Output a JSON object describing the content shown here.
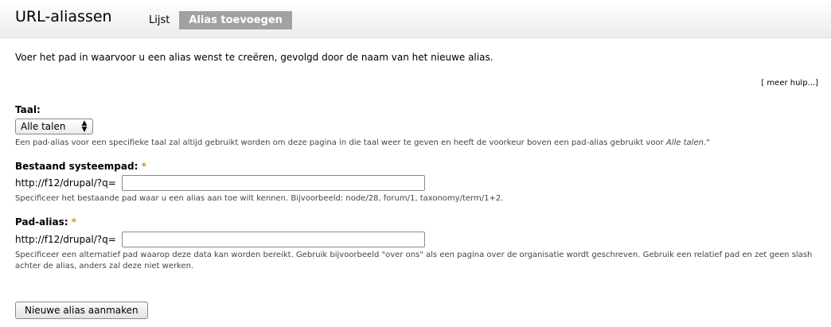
{
  "header": {
    "title": "URL-aliassen",
    "tabs": [
      {
        "label": "Lijst",
        "active": false
      },
      {
        "label": "Alias toevoegen",
        "active": true
      }
    ]
  },
  "intro": "Voer het pad in waarvoor u een alias wenst te creëren, gevolgd door de naam van het nieuwe alias.",
  "more_help": "[ meer hulp...]",
  "language": {
    "label": "Taal:",
    "selected": "Alle talen",
    "description_main": "Een pad-alias voor een specifieke taal zal altijd gebruikt worden om deze pagina in die taal weer te geven en heeft de voorkeur boven een pad-alias gebruikt voor ",
    "description_em": "Alle talen",
    "description_end": ".\""
  },
  "system_path": {
    "label": "Bestaand systeempad:",
    "required_mark": "*",
    "prefix": "http://f12/drupal/?q=",
    "value": "",
    "description": "Specificeer het bestaande pad waar u een alias aan toe wilt kennen. Bijvoorbeeld: node/28, forum/1, taxonomy/term/1+2."
  },
  "path_alias": {
    "label": "Pad-alias:",
    "required_mark": "*",
    "prefix": "http://f12/drupal/?q=",
    "value": "",
    "description_line1": "Specificeer een alternatief pad waarop deze data kan worden bereikt. Gebruik bijvoorbeeld \"over ons\" als een pagina over de organisatie wordt geschreven. Gebruik een relatief pad en zet geen slash",
    "description_line2": "achter de alias, anders zal deze niet werken."
  },
  "submit_label": "Nieuwe alias aanmaken",
  "colors": {
    "active_tab_bg": "#a1a1a1",
    "required": "#e09010"
  }
}
